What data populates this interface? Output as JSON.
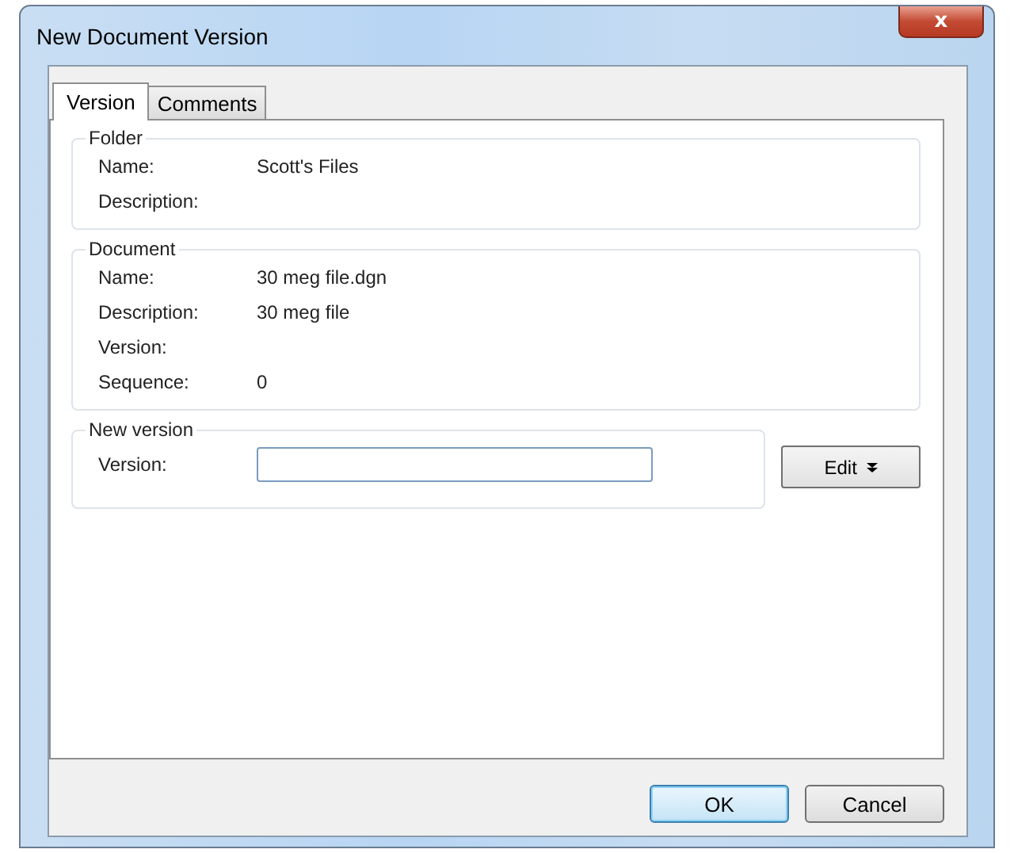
{
  "window": {
    "title": "New Document Version",
    "close_label": "x"
  },
  "tabs": [
    {
      "label": "Version",
      "selected": true
    },
    {
      "label": "Comments",
      "selected": false
    }
  ],
  "groups": [
    {
      "title": "Folder",
      "fields": [
        {
          "label": "Name:",
          "value": "Scott's Files"
        },
        {
          "label": "Description:"
        }
      ]
    },
    {
      "title": "Document",
      "fields": [
        {
          "label": "Name:",
          "value": "30 meg file.dgn"
        },
        {
          "label": "Description:",
          "value": "30 meg file"
        },
        {
          "label": "Version:"
        },
        {
          "label": "Sequence:",
          "value": "0"
        }
      ]
    }
  ],
  "new_version": {
    "title": "New version",
    "label": "Version:",
    "edit_button": "Edit"
  },
  "buttons": [
    {
      "label": "OK",
      "default": true
    },
    {
      "label": "Cancel",
      "default": false
    }
  ]
}
